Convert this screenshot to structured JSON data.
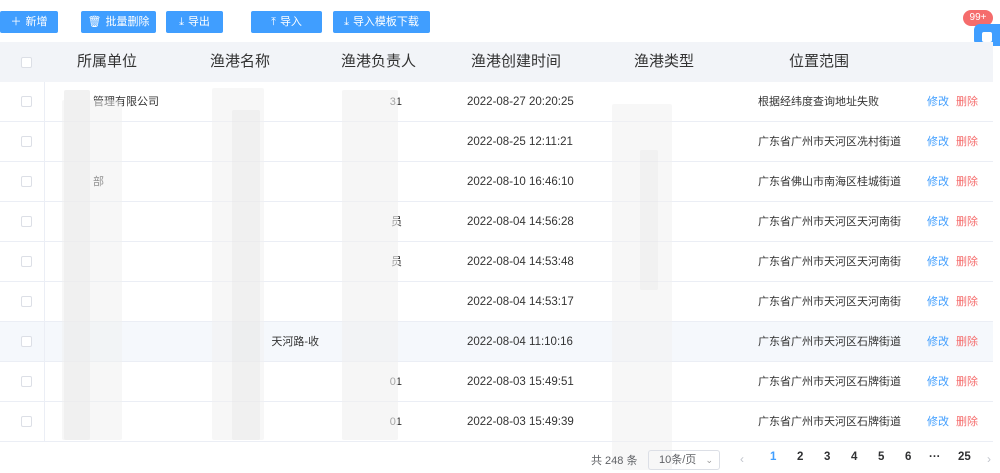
{
  "toolbar": {
    "add_label": "新增",
    "batch_delete_label": "批量删除",
    "export_label": "导出",
    "import_label": "导入",
    "template_download_label": "导入模板下载",
    "badge": "99+"
  },
  "table": {
    "headers": {
      "unit": "所属单位",
      "name": "渔港名称",
      "owner": "渔港负责人",
      "created": "渔港创建时间",
      "type": "渔港类型",
      "location": "位置范围"
    },
    "rows": [
      {
        "unit": "管理有限公司",
        "name": "",
        "owner": "31",
        "created": "2022-08-27 20:20:25",
        "location": "根据经纬度查询地址失败",
        "edit": "修改",
        "delete": "删除"
      },
      {
        "unit": "",
        "name": "",
        "owner": "",
        "created": "2022-08-25 12:11:21",
        "location": "广东省广州市天河区冼村街道",
        "edit": "修改",
        "delete": "删除"
      },
      {
        "unit": "部",
        "name": "",
        "owner": "",
        "created": "2022-08-10 16:46:10",
        "location": "广东省佛山市南海区桂城街道",
        "edit": "修改",
        "delete": "删除"
      },
      {
        "unit": "",
        "name": "",
        "owner": "员",
        "created": "2022-08-04 14:56:28",
        "location": "广东省广州市天河区天河南街",
        "edit": "修改",
        "delete": "删除"
      },
      {
        "unit": "",
        "name": "",
        "owner": "员",
        "created": "2022-08-04 14:53:48",
        "location": "广东省广州市天河区天河南街",
        "edit": "修改",
        "delete": "删除"
      },
      {
        "unit": "",
        "name": "",
        "owner": "",
        "created": "2022-08-04 14:53:17",
        "location": "广东省广州市天河区天河南街",
        "edit": "修改",
        "delete": "删除"
      },
      {
        "unit": "",
        "name": "天河路-收",
        "owner": "",
        "created": "2022-08-04 11:10:16",
        "location": "广东省广州市天河区石牌街道",
        "edit": "修改",
        "delete": "删除"
      },
      {
        "unit": "",
        "name": "",
        "owner": "01",
        "created": "2022-08-03 15:49:51",
        "location": "广东省广州市天河区石牌街道",
        "edit": "修改",
        "delete": "删除"
      },
      {
        "unit": "",
        "name": "",
        "owner": "01",
        "created": "2022-08-03 15:49:39",
        "location": "广东省广州市天河区石牌街道",
        "edit": "修改",
        "delete": "删除"
      }
    ]
  },
  "pagination": {
    "total": "共 248 条",
    "page_size": "10条/页",
    "prev": "‹",
    "next": "›",
    "pages": [
      "1",
      "2",
      "3",
      "4",
      "5",
      "6",
      "···",
      "25"
    ],
    "active": "1"
  },
  "colors": {
    "primary": "#409eff",
    "danger": "#f56c6c",
    "header_bg": "#f2f4f8"
  }
}
